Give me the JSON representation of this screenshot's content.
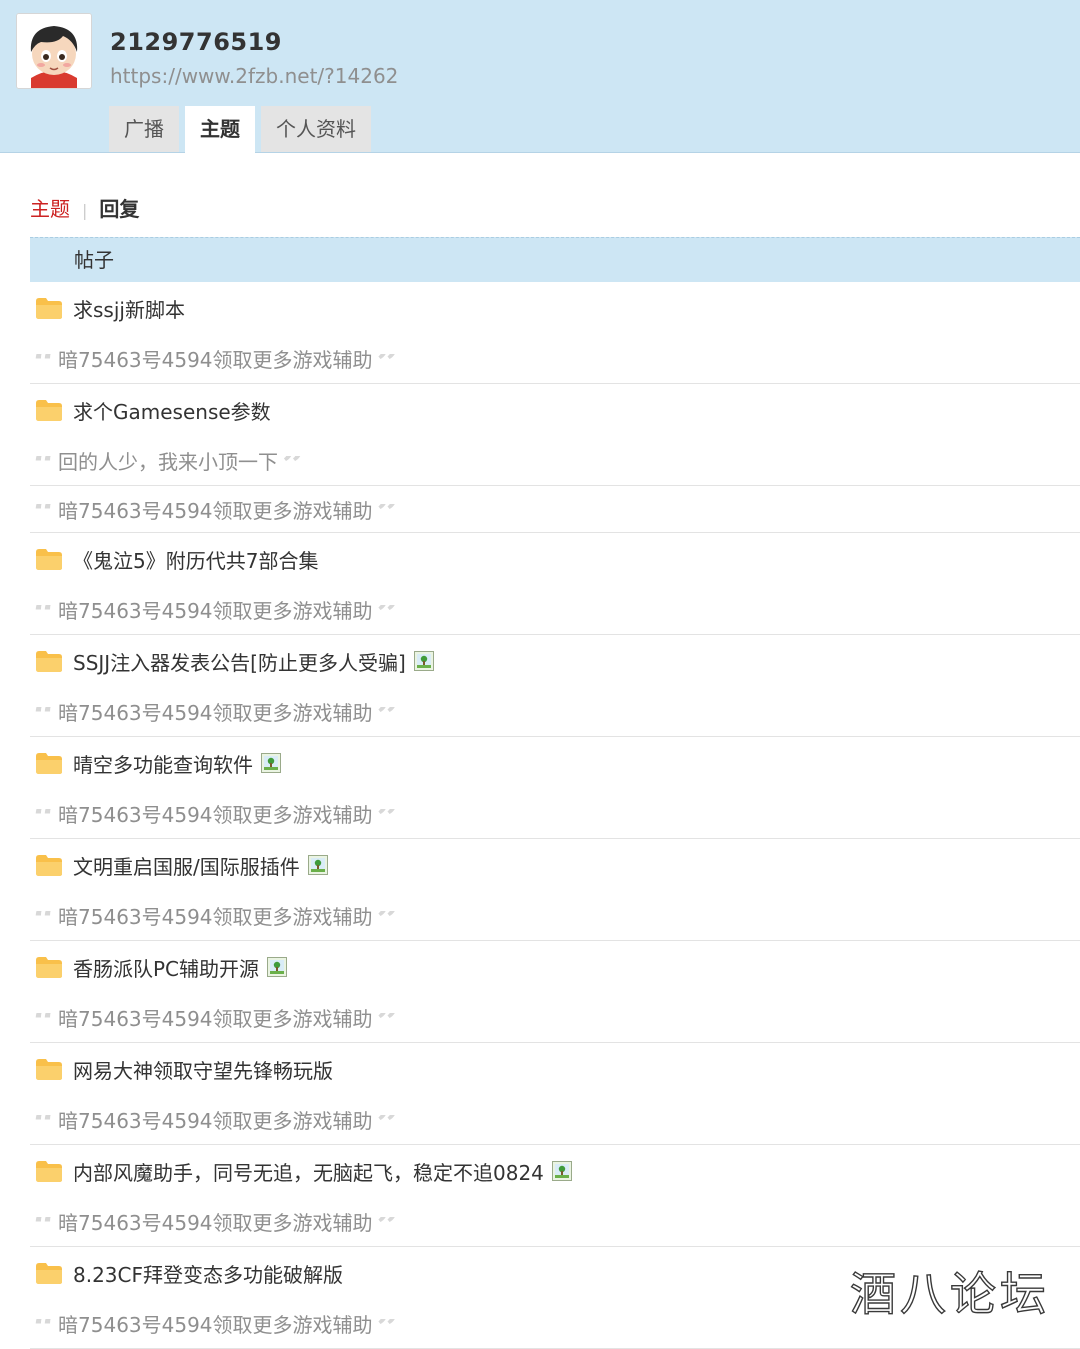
{
  "profile": {
    "uid": "2129776519",
    "url": "https://www.2fzb.net/?14262"
  },
  "tabs": [
    {
      "label": "广播",
      "active": false
    },
    {
      "label": "主题",
      "active": true
    },
    {
      "label": "个人资料",
      "active": false
    }
  ],
  "subnav": {
    "topic": "主题",
    "separator": "|",
    "reply": "回复"
  },
  "list_header": "帖子",
  "items": [
    {
      "title": "求ssjj新脚本",
      "has_image": false,
      "replies": [
        "暗75463号4594领取更多游戏辅助"
      ]
    },
    {
      "title": "求个Gamesense参数",
      "has_image": false,
      "replies": [
        "回的人少，我来小顶一下",
        "暗75463号4594领取更多游戏辅助"
      ]
    },
    {
      "title": "《鬼泣5》附历代共7部合集",
      "has_image": false,
      "replies": [
        "暗75463号4594领取更多游戏辅助"
      ]
    },
    {
      "title": "SSJJ注入器发表公告[防止更多人受骗]",
      "has_image": true,
      "replies": [
        "暗75463号4594领取更多游戏辅助"
      ]
    },
    {
      "title": "晴空多功能查询软件",
      "has_image": true,
      "replies": [
        "暗75463号4594领取更多游戏辅助"
      ]
    },
    {
      "title": "文明重启国服/国际服插件",
      "has_image": true,
      "replies": [
        "暗75463号4594领取更多游戏辅助"
      ]
    },
    {
      "title": "香肠派队PC辅助开源",
      "has_image": true,
      "replies": [
        "暗75463号4594领取更多游戏辅助"
      ]
    },
    {
      "title": "网易大神领取守望先锋畅玩版",
      "has_image": false,
      "replies": [
        "暗75463号4594领取更多游戏辅助"
      ]
    },
    {
      "title": "内部风魔助手，同号无追，无脑起飞，稳定不追0824",
      "has_image": true,
      "replies": [
        "暗75463号4594领取更多游戏辅助"
      ]
    },
    {
      "title": "8.23CF拜登变态多功能破解版",
      "has_image": false,
      "replies": [
        "暗75463号4594领取更多游戏辅助"
      ]
    }
  ],
  "watermark": "酒八论坛",
  "icons": {
    "avatar": "avatar-cartoon-icon",
    "folder": "folder-icon",
    "image_attachment": "image-attachment-icon",
    "quote_open": "quote-open-icon",
    "quote_close": "quote-close-icon"
  },
  "colors": {
    "header_bg": "#cde6f4",
    "active_subnav": "#cc2222",
    "folder": "#f9c04a"
  }
}
